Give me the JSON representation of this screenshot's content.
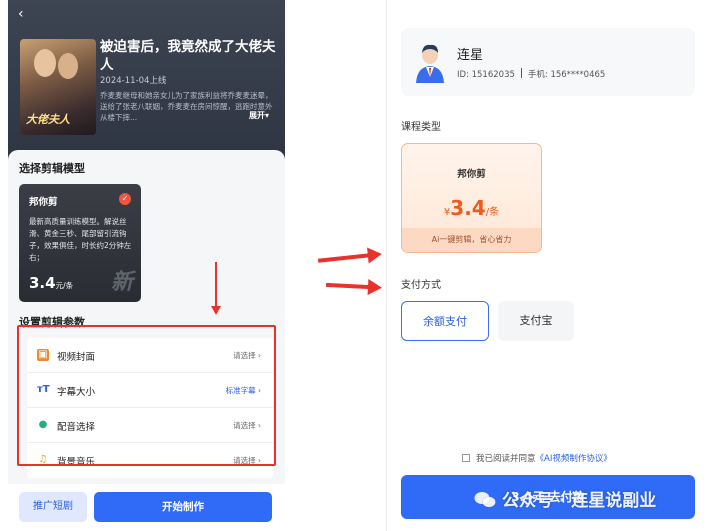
{
  "left": {
    "back_icon": "chevron-left-icon",
    "drama": {
      "title": "被迫害后，我竟然成了大佬夫人",
      "date": "2024-11-04上线",
      "description": "乔麦麦继母和她亲女儿为了家族利益将乔麦麦迷晕，送给了张老八联姻，乔麦麦在房间惊醒，逃跑时意外从楼下摔...",
      "expand_label": "展开▾",
      "poster_title": "大佬夫人"
    },
    "model_section_title": "选择剪辑模型",
    "model_card": {
      "name": "邦你剪",
      "description": "最新高质量训练模型。解说丝滑、黄金三秒、尾部留引流钩子，效果俱佳，时长约2分钟左右；",
      "price": "3.4",
      "unit": "元/条",
      "logo_text": "新"
    },
    "params_section_title": "设置剪辑参数",
    "params": [
      {
        "icon": "video-cover-icon",
        "label": "视频封面",
        "value": "请选择 ›",
        "value_color": "#666666"
      },
      {
        "icon": "font-size-icon",
        "label": "字幕大小",
        "value": "标准字幕 ›",
        "value_color": "#2a5fe0"
      },
      {
        "icon": "voice-icon",
        "label": "配音选择",
        "value": "请选择 ›",
        "value_color": "#666666"
      },
      {
        "icon": "music-icon",
        "label": "背景音乐",
        "value": "请选择 ›",
        "value_color": "#666666"
      }
    ],
    "promo_button": "推广短剧",
    "start_button": "开始制作"
  },
  "right": {
    "user": {
      "name": "连星",
      "id_text": "ID: 15162035",
      "phone_text": "手机: 156****0465"
    },
    "course_section_title": "课程类型",
    "course": {
      "name": "邦你剪",
      "currency": "¥",
      "price": "3.4",
      "unit": "/条",
      "tag": "Ai一键剪辑，省心省力"
    },
    "payment_section_title": "支付方式",
    "payment_options": [
      "余额支付",
      "支付宝"
    ],
    "agreement_prefix": "我已阅读并同意",
    "agreement_link": "《AI视频制作协议》",
    "pay_button": "3.4元 去付款"
  },
  "watermark": "公众号 · 连星说副业",
  "colors": {
    "accent_blue": "#2f6bf6",
    "annotation_red": "#e8322b",
    "price_orange": "#ee5a1a"
  }
}
